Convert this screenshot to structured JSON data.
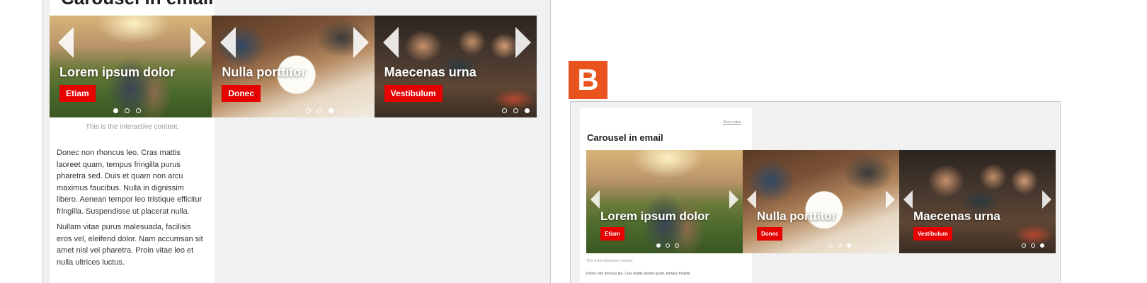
{
  "panel_a": {
    "heading": "Carousel in email",
    "slides": [
      {
        "title": "Lorem ipsum dolor",
        "button": "Etiam"
      },
      {
        "title": "Nulla porttitor",
        "button": "Donec"
      },
      {
        "title": "Maecenas urna",
        "button": "Vestibulum"
      }
    ],
    "caption": "This is the interactive content.",
    "paragraphs": [
      "Donec non rhoncus leo. Cras mattis laoreet quam, tempus fringilla purus pharetra sed. Duis et quam non arcu maximus faucibus. Nulla in dignissim libero. Aenean tempor leo tristique efficitur fringilla. Suspendisse ut placerat nulla.",
      "Nullam vitae purus malesuada, facilisis eros vel, eleifend dolor. Nam accumsan sit amet nisl vel pharetra. Proin vitae leo et nulla ultrices luctus."
    ]
  },
  "badge": {
    "letter": "B",
    "color": "#e8531e"
  },
  "panel_b": {
    "view_online": "View online",
    "heading": "Carousel in email",
    "slides": [
      {
        "title": "Lorem ipsum dolor",
        "button": "Etiam"
      },
      {
        "title": "Nulla porttitor",
        "button": "Donec"
      },
      {
        "title": "Maecenas urna",
        "button": "Vestibulum"
      }
    ],
    "caption": "This is the interactive content.",
    "body": "Donec non rhoncus leo. Cras mattis laoreet quam, tempus fringilla"
  },
  "colors": {
    "accent": "#e60000",
    "background": "#f1f1f1"
  }
}
